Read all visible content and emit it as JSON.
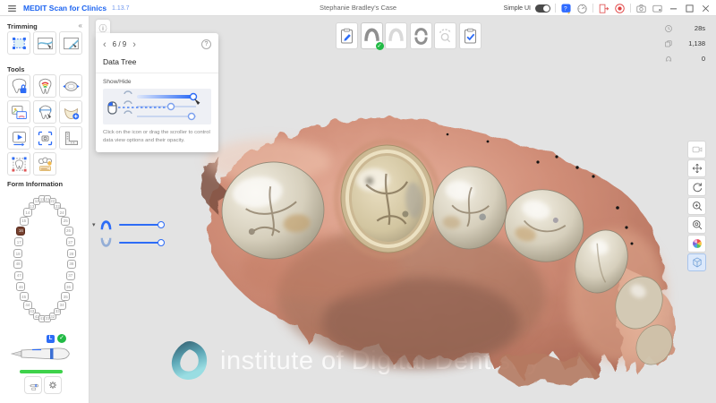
{
  "title_bar": {
    "app_name": "MEDIT Scan for Clinics",
    "version": "1.13.7",
    "case_title": "Stephanie Bradley's Case",
    "simple_ui_label": "Simple UI",
    "simple_ui_on": true,
    "icons": [
      {
        "sep": true
      },
      {
        "name": "help-button",
        "icon": "help-bubble"
      },
      {
        "name": "performance-gauge-button",
        "icon": "gauge"
      },
      {
        "sep": true
      },
      {
        "name": "exit-button",
        "icon": "exit-door"
      },
      {
        "name": "record-button",
        "icon": "record"
      },
      {
        "sep": true
      },
      {
        "name": "screenshot-button",
        "icon": "camera"
      },
      {
        "name": "screen-capture-button",
        "icon": "screen-rec"
      },
      {
        "name": "minimize-button",
        "icon": "minimize"
      },
      {
        "name": "maximize-button",
        "icon": "maximize"
      },
      {
        "name": "close-button",
        "icon": "close"
      }
    ]
  },
  "sidebar": {
    "trimming": {
      "title": "Trimming",
      "collapse_icon": "«",
      "buttons": [
        {
          "name": "trim-polygon-button",
          "icon": "trim-polygon"
        },
        {
          "name": "trim-curve-button",
          "icon": "trim-curve"
        },
        {
          "name": "trim-line-button",
          "icon": "trim-line"
        }
      ]
    },
    "tools": {
      "title": "Tools",
      "buttons": [
        {
          "name": "tooth-lock-button",
          "icon": "tooth-lock"
        },
        {
          "name": "occlusion-analysis-button",
          "icon": "occlusion-analysis"
        },
        {
          "name": "arch-adjust-button",
          "icon": "arch-adjust"
        },
        {
          "name": "image-match-button",
          "icon": "image-match"
        },
        {
          "name": "tooth-measure-button",
          "icon": "tooth-measure"
        },
        {
          "name": "arch-complete-button",
          "icon": "arch-complete"
        },
        {
          "name": "replay-button",
          "icon": "replay"
        },
        {
          "name": "capture-button",
          "icon": "capture"
        },
        {
          "name": "angle-ruler-button",
          "icon": "angle-ruler"
        },
        {
          "name": "frame-tooth-button",
          "icon": "frame-tooth"
        },
        {
          "name": "teeth-lock-button",
          "icon": "teeth-lock"
        }
      ]
    },
    "form_information": {
      "title": "Form Information",
      "highlighted_tooth": "16",
      "upper_teeth": [
        "18",
        "17",
        "16",
        "15",
        "14",
        "13",
        "12",
        "11",
        "21",
        "22",
        "23",
        "24",
        "25",
        "26",
        "27",
        "28"
      ],
      "lower_teeth": [
        "48",
        "47",
        "46",
        "45",
        "44",
        "43",
        "42",
        "41",
        "31",
        "32",
        "33",
        "34",
        "35",
        "36",
        "37",
        "38"
      ]
    },
    "scanner": {
      "badge": "L",
      "status": "connected",
      "check_glyph": "✓"
    }
  },
  "stage_toolbar": {
    "buttons": [
      {
        "name": "form-stage-button",
        "icon": "stage-form",
        "state": "normal"
      },
      {
        "name": "maxilla-stage-button",
        "icon": "stage-maxilla",
        "state": "active",
        "checked": true
      },
      {
        "name": "mandible-stage-button",
        "icon": "stage-mandible",
        "state": "normal"
      },
      {
        "name": "occlusion-stage-button",
        "icon": "stage-occlusion",
        "state": "normal"
      },
      {
        "name": "scan-align-stage-button",
        "icon": "stage-scan",
        "state": "disabled"
      },
      {
        "name": "complete-stage-button",
        "icon": "stage-complete",
        "state": "normal"
      }
    ],
    "check_glyph": "✓"
  },
  "help_panel": {
    "page": "6 / 9",
    "prev_glyph": "‹",
    "next_glyph": "›",
    "help_glyph": "?",
    "info_glyph": "ⓘ",
    "title": "Data Tree",
    "section_label": "Show/Hide",
    "caption": "Click on the icon or drag the scroller to control data view options and their opacity."
  },
  "stats": {
    "rows": [
      {
        "name": "scan-time",
        "icon": "timer-icon",
        "value": "28s"
      },
      {
        "name": "image-count",
        "icon": "layers-icon",
        "value": "1,138"
      },
      {
        "name": "arch-count",
        "icon": "arch-icon",
        "value": "0"
      }
    ]
  },
  "view_toolbar": {
    "buttons": [
      {
        "name": "viewport-capture-button",
        "icon": "view-camera",
        "state": "disabled"
      },
      {
        "name": "pan-button",
        "icon": "view-pan",
        "state": "normal"
      },
      {
        "name": "rotate-button",
        "icon": "view-rotate",
        "state": "normal"
      },
      {
        "name": "zoom-in-button",
        "icon": "view-zoom-in",
        "state": "normal"
      },
      {
        "name": "zoom-fit-button",
        "icon": "view-zoom-fit",
        "state": "normal"
      },
      {
        "name": "color-texture-button",
        "icon": "view-color-sphere",
        "state": "normal"
      },
      {
        "name": "view-cube-button",
        "icon": "view-cube",
        "state": "active"
      }
    ]
  },
  "opacity_controls": {
    "caret_glyph": "▾",
    "rows": [
      {
        "name": "maxilla-opacity",
        "icon": "maxilla-small",
        "value": 100
      },
      {
        "name": "mandible-opacity",
        "icon": "mandible-small",
        "value": 100
      }
    ]
  },
  "watermark": {
    "text": "institute of Digital Dentistry"
  },
  "colors": {
    "accent": "#2d6cf6",
    "success": "#21ba45",
    "record_red": "#e04343",
    "gum_pink": "#cf8a75",
    "tooth_ivory": "#d9d2c1",
    "viewport_bg": "#e3e3e3"
  }
}
